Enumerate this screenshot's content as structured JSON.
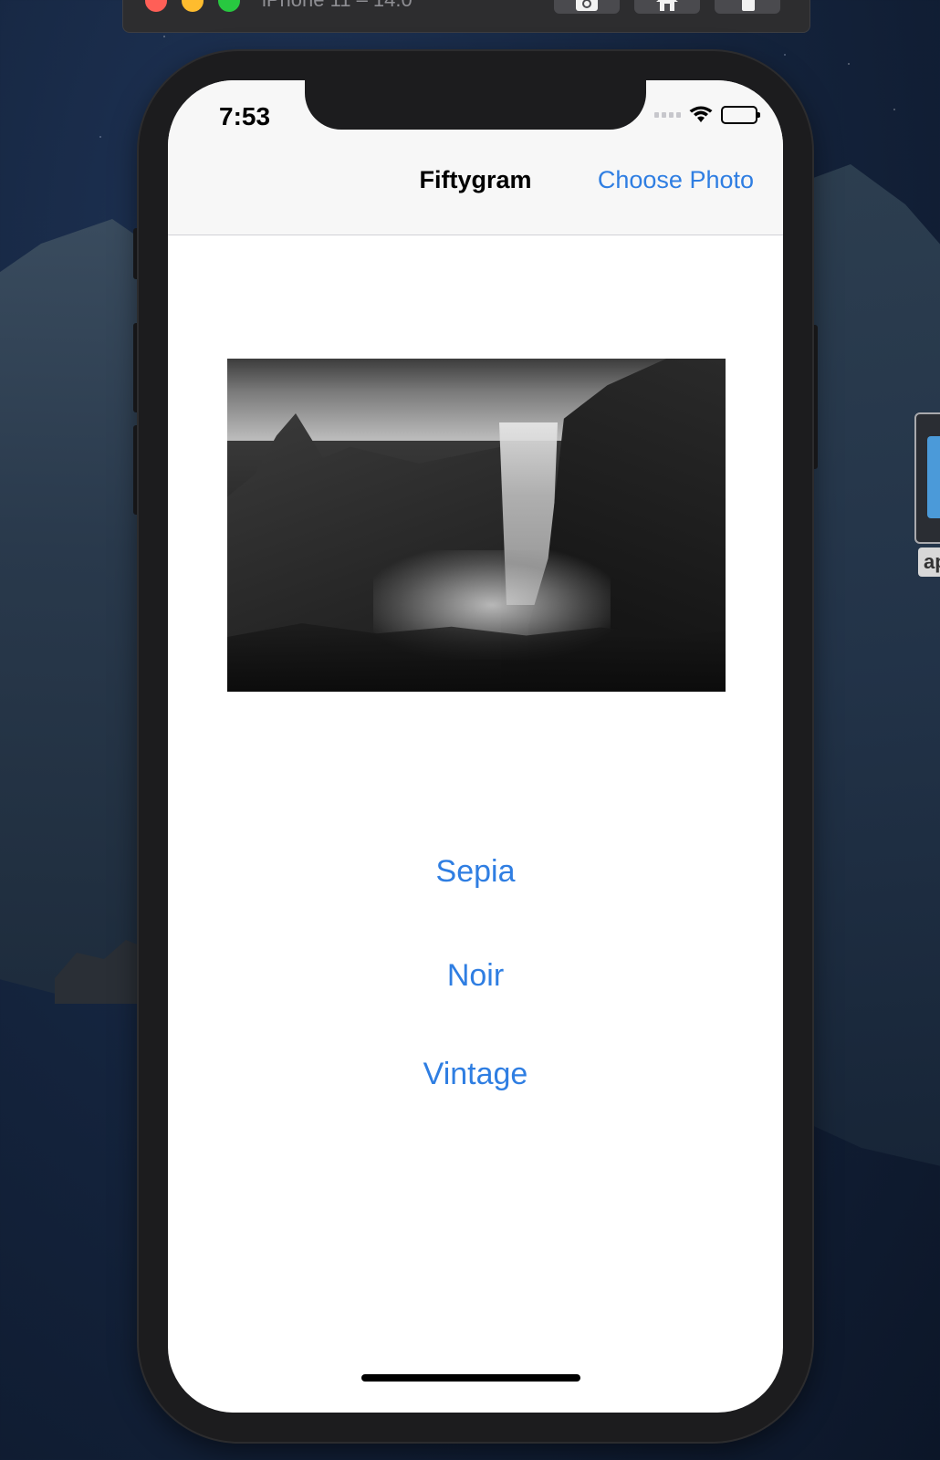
{
  "simulator": {
    "title": "iPhone 11 – 14.0",
    "buttons": [
      "screenshot-icon",
      "home-icon",
      "rotate-icon"
    ]
  },
  "desktop": {
    "edge_label": "ap"
  },
  "status_bar": {
    "time": "7:53",
    "icons": [
      "signal-icon",
      "wifi-icon",
      "battery-icon"
    ]
  },
  "nav_bar": {
    "title": "Fiftygram",
    "right_action": "Choose Photo"
  },
  "filters": {
    "sepia": "Sepia",
    "noir": "Noir",
    "vintage": "Vintage"
  },
  "colors": {
    "accent": "#2f7ee2",
    "nav_background": "#f7f7f7",
    "device_frame": "#1c1c1e"
  }
}
